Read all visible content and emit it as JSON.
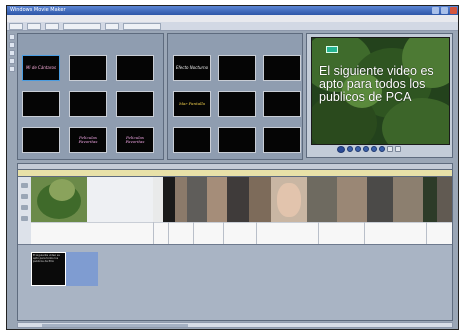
{
  "window": {
    "title": "Windows Movie Maker"
  },
  "menu": {
    "items": []
  },
  "panes": {
    "left": {
      "header": "",
      "tiles": [
        "Mi de Cántaros",
        "",
        "",
        "",
        "",
        "",
        "",
        "Peliculas Favoritas",
        "Peliculas Favoritas"
      ]
    },
    "right": {
      "header": "",
      "tiles": [
        "Efecto Nocturno",
        "",
        "",
        "Mar Pantalla",
        "",
        "",
        "",
        "",
        ""
      ]
    }
  },
  "preview": {
    "caption": "El siguiente video es apto para todos los publicos de PCA"
  },
  "storyboard": {
    "header_label": ""
  },
  "timeline": {
    "title_clip_text": "El siguiente video es apto para todos los publicos de PCA"
  },
  "colors": {
    "window_bg": "#9aa6b6",
    "titlebar": "#2d56a8",
    "ruler": "#e8e1a8",
    "selected_clip": "#7f9cd1"
  }
}
